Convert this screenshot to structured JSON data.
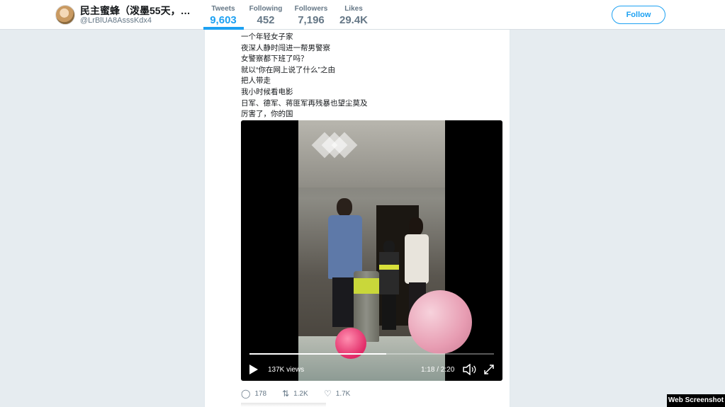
{
  "profile": {
    "display_name": "民主蜜蜂（泼墨55天，…",
    "handle": "@LrBlUA8AsssKdx4"
  },
  "stats": [
    {
      "label": "Tweets",
      "value": "9,603"
    },
    {
      "label": "Following",
      "value": "452"
    },
    {
      "label": "Followers",
      "value": "7,196"
    },
    {
      "label": "Likes",
      "value": "29.4K"
    }
  ],
  "follow_label": "Follow",
  "tweet": {
    "lines": [
      "一个年轻女子家",
      "夜深人静时闯进一帮男警察",
      "女警察都下班了吗？",
      "就以“你在网上说了什么”之由",
      "把人带走",
      "我小时候看电影",
      "日军、德军、蒋匪军再残暴也望尘莫及",
      "厉害了，你的国"
    ],
    "video": {
      "views": "137K views",
      "time": "1:18 / 2:20",
      "progress": 0.56
    },
    "actions": {
      "replies": "178",
      "retweets": "1.2K",
      "likes": "1.7K"
    }
  },
  "watermark": "Web Screenshot",
  "colors": {
    "accent": "#1da1f2",
    "page_bg": "#e6ecf0"
  }
}
